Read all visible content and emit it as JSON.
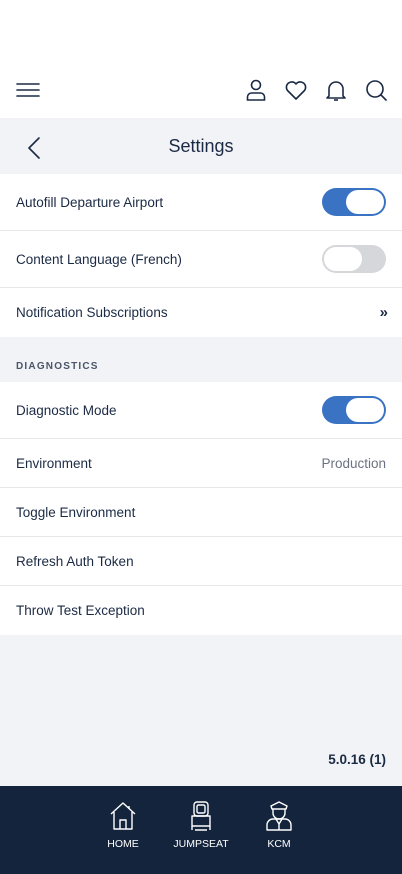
{
  "topbar": {
    "icons": [
      "menu-icon",
      "profile-icon",
      "heart-icon",
      "bell-icon",
      "search-icon"
    ]
  },
  "header": {
    "title": "Settings",
    "back_icon": "chevron-left-icon"
  },
  "settings": [
    {
      "label": "Autofill Departure Airport",
      "toggle": "on"
    },
    {
      "label": "Content Language (French)",
      "toggle": "off"
    },
    {
      "label": "Notification Subscriptions",
      "icon": "double-chevron-right-icon"
    }
  ],
  "diagnostics": {
    "header": "DIAGNOSTICS",
    "items": [
      {
        "label": "Diagnostic Mode",
        "toggle": "on"
      },
      {
        "label": "Environment",
        "value": "Production"
      },
      {
        "label": "Toggle Environment"
      },
      {
        "label": "Refresh Auth Token"
      },
      {
        "label": "Throw Test Exception"
      }
    ]
  },
  "version": "5.0.16 (1)",
  "tabs": [
    {
      "label": "HOME",
      "icon": "home-icon"
    },
    {
      "label": "JUMPSEAT",
      "icon": "seat-icon"
    },
    {
      "label": "KCM",
      "icon": "pilot-icon"
    }
  ],
  "colors": {
    "accent": "#3a73c4",
    "navy": "#14243c",
    "background": "#f2f3f6"
  }
}
